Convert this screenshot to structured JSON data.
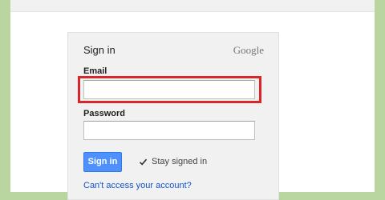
{
  "signin": {
    "title": "Sign in",
    "brand": "Google",
    "email_label": "Email",
    "email_value": "",
    "password_label": "Password",
    "password_value": "",
    "signin_button": "Sign in",
    "stay_signed_in": "Stay signed in",
    "stay_signed_in_checked": true,
    "help_link": "Can't access your account?"
  },
  "colors": {
    "background_frame": "#b9d5a0",
    "highlight_box": "#d8262b",
    "button_blue": "#4d90fe",
    "link_blue": "#1155cc"
  },
  "icons": {
    "checkbox": "check-icon"
  }
}
